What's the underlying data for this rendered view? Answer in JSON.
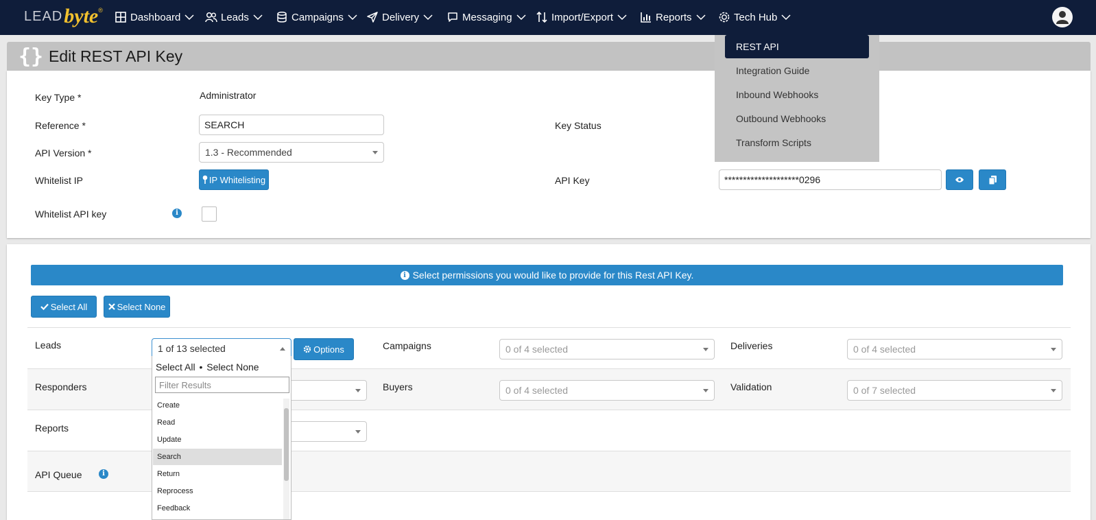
{
  "brand": {
    "lead": "LEAD",
    "byte": "byte",
    "tm": "®"
  },
  "nav": {
    "items": [
      {
        "label": "Dashboard"
      },
      {
        "label": "Leads"
      },
      {
        "label": "Campaigns"
      },
      {
        "label": "Delivery"
      },
      {
        "label": "Messaging"
      },
      {
        "label": "Import/Export"
      },
      {
        "label": "Reports"
      },
      {
        "label": "Tech Hub"
      }
    ]
  },
  "techhub_menu": [
    "REST API",
    "Integration Guide",
    "Inbound Webhooks",
    "Outbound Webhooks",
    "Transform Scripts"
  ],
  "page": {
    "title": "Edit REST API Key"
  },
  "form": {
    "key_type_label": "Key Type *",
    "key_type_value": "Administrator",
    "reference_label": "Reference *",
    "reference_value": "SEARCH",
    "api_version_label": "API Version *",
    "api_version_value": "1.3 - Recommended",
    "whitelist_ip_label": "Whitelist IP",
    "ip_whitelisting_button": "IP Whitelisting",
    "whitelist_api_key_label": "Whitelist API key",
    "key_status_label": "Key Status",
    "api_key_label": "API Key",
    "api_key_value": "********************0296"
  },
  "permissions": {
    "banner": "Select permissions you would like to provide for this Rest API Key.",
    "select_all": "Select All",
    "select_none": "Select None",
    "options_button": "Options",
    "rows": [
      {
        "label": "Leads",
        "value": "1 of 13 selected"
      },
      {
        "label": "Campaigns",
        "value": "0 of 4 selected"
      },
      {
        "label": "Deliveries",
        "value": "0 of 4 selected"
      },
      {
        "label": "Responders",
        "value": ""
      },
      {
        "label": "Buyers",
        "value": "0 of 4 selected"
      },
      {
        "label": "Validation",
        "value": "0 of 7 selected"
      },
      {
        "label": "Reports",
        "value": ""
      },
      {
        "label": "API Queue",
        "value": ""
      }
    ],
    "dropdown": {
      "select_all": "Select All",
      "separator": "•",
      "select_none": "Select None",
      "filter_placeholder": "Filter Results",
      "options": [
        "Create",
        "Read",
        "Update",
        "Search",
        "Return",
        "Reprocess",
        "Feedback"
      ]
    }
  },
  "colors": {
    "navbar": "#0f1d3a",
    "accent": "#2a88c8",
    "logo": "#f2c12e"
  }
}
